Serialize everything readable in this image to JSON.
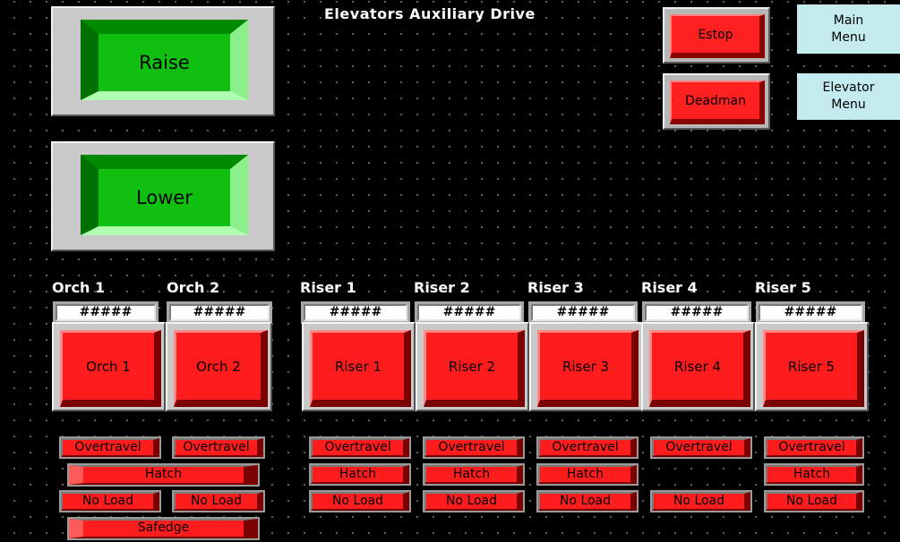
{
  "title": "Elevators Auxiliary Drive",
  "raise_label": "Raise",
  "lower_label": "Lower",
  "estop_label": "Estop",
  "deadman_label": "Deadman",
  "main_menu": {
    "line1": "Main",
    "line2": "Menu"
  },
  "elevator_menu": {
    "line1": "Elevator",
    "line2": "Menu"
  },
  "columns": [
    {
      "header": "Orch 1",
      "display": "#####",
      "button": "Orch 1",
      "overtravel": "Overtravel"
    },
    {
      "header": "Orch 2",
      "display": "#####",
      "button": "Orch 2",
      "overtravel": "Overtravel"
    },
    {
      "header": "Riser 1",
      "display": "#####",
      "button": "Riser 1",
      "overtravel": "Overtravel",
      "hatch": "Hatch",
      "no_load": "No Load"
    },
    {
      "header": "Riser 2",
      "display": "#####",
      "button": "Riser 2",
      "overtravel": "Overtravel",
      "hatch": "Hatch",
      "no_load": "No Load"
    },
    {
      "header": "Riser 3",
      "display": "#####",
      "button": "Riser 3",
      "overtravel": "Overtravel",
      "hatch": "Hatch",
      "no_load": "No Load"
    },
    {
      "header": "Riser 4",
      "display": "#####",
      "button": "Riser 4",
      "overtravel": "Overtravel",
      "no_load": "No Load"
    },
    {
      "header": "Riser 5",
      "display": "#####",
      "button": "Riser 5",
      "overtravel": "Overtravel",
      "hatch": "Hatch",
      "no_load": "No Load"
    }
  ],
  "orch_shared": {
    "hatch": "Hatch",
    "no_load_1": "No Load",
    "no_load_2": "No Load",
    "safedge": "Safedge"
  },
  "colors": {
    "background": "#000000",
    "button_red": "#ff1c1c",
    "button_green": "#10c010",
    "menu_cyan": "#c4ecef"
  }
}
